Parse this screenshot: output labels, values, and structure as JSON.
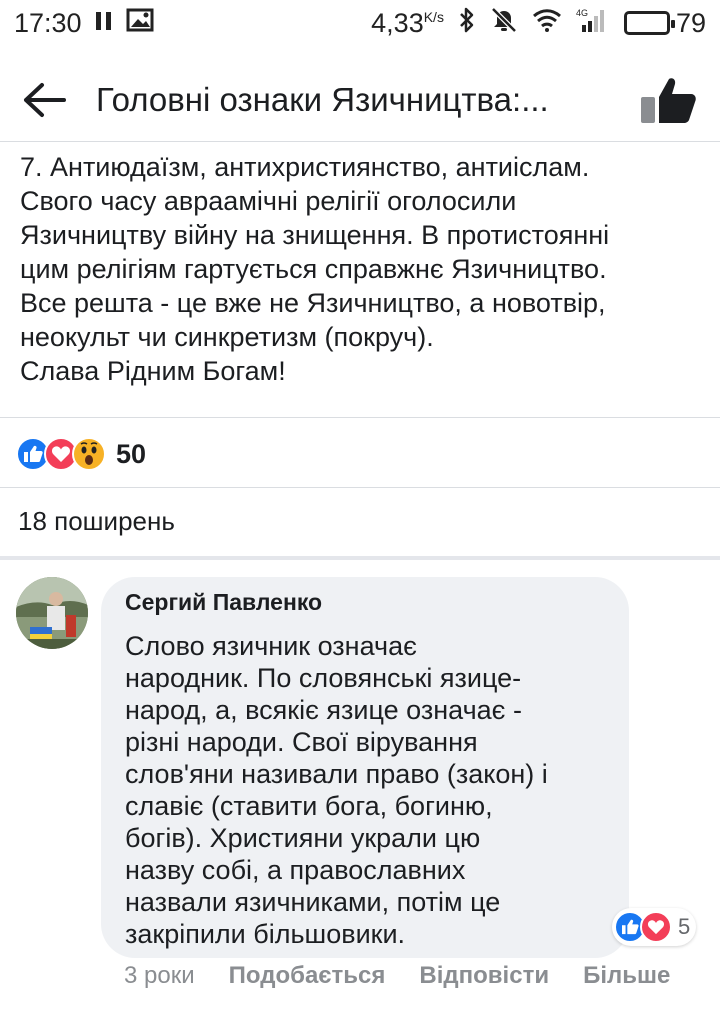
{
  "status_bar": {
    "time": "17:30",
    "net_speed": "4,33",
    "net_speed_unit": "K/s",
    "network_type": "4G",
    "battery": "79",
    "battery_level": 0.79
  },
  "header": {
    "title": "Головні ознаки Язичництва:..."
  },
  "post": {
    "text": "7. Антиюдаїзм, антихристиянство, антиіслам.\nСвого часу авраамічні релігії оголосили\nЯзичництву війну на знищення. В протистоянні\nцим релігіям гартується справжнє Язичництво.\nВсе решта - це вже не Язичництво, а новотвір,\nнеокульт чи синкретизм (покруч).\nСлава Рідним Богам!",
    "reaction_count": "50",
    "shares": "18 поширень"
  },
  "comment": {
    "author": "Сергий Павленко",
    "text": "Слово язичник означає\nнародник. По словянські язице-\nнарод, а, всякіє язице означає -\nрізні народи. Свої вірування\nслов'яни називали право (закон) і\nславіє (ставити бога, богиню,\nбогів). Християни украли цю\nназву собі, а православних\nназвали язичниками, потім це\nзакріпили більшовики.",
    "reaction_count": "5",
    "time": "3 роки",
    "like_label": "Подобається",
    "reply_label": "Відповісти",
    "more_label": "Більше"
  },
  "colors": {
    "like_blue": "#1877f2",
    "love_red": "#f33e58",
    "wow_yellow": "#f7b125",
    "bubble_bg": "#eff1f4",
    "meta_gray": "#8a8d91"
  }
}
